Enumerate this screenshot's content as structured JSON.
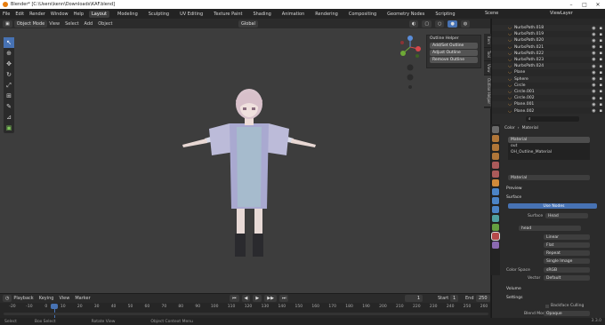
{
  "title_bar": {
    "text": "Blender* [C:\\Users\\kenn\\Downloads\\KAF.blend]"
  },
  "menu": [
    "File",
    "Edit",
    "Render",
    "Window",
    "Help"
  ],
  "workspaces": [
    {
      "label": "Layout",
      "active": true
    },
    {
      "label": "Modeling"
    },
    {
      "label": "Sculpting"
    },
    {
      "label": "UV Editing"
    },
    {
      "label": "Texture Paint"
    },
    {
      "label": "Shading"
    },
    {
      "label": "Animation"
    },
    {
      "label": "Rendering"
    },
    {
      "label": "Compositing"
    },
    {
      "label": "Geometry Nodes"
    },
    {
      "label": "Scripting"
    }
  ],
  "scene": {
    "label": "Scene"
  },
  "view_layer": {
    "label": "ViewLayer"
  },
  "viewport_header": {
    "mode": "Object Mode",
    "menus": [
      "View",
      "Select",
      "Add",
      "Object"
    ],
    "orientation": "Global",
    "options": "Options"
  },
  "outline_helper": {
    "title": "Outline Helper",
    "buttons": [
      "Add/Set Outline",
      "Adjust Outline",
      "Remove Outline"
    ]
  },
  "side_tabs": [
    "Item",
    "Tool",
    "View",
    "Outline Helper"
  ],
  "outliner": {
    "items": [
      "NurbsPath.018",
      "NurbsPath.019",
      "NurbsPath.020",
      "NurbsPath.021",
      "NurbsPath.022",
      "NurbsPath.023",
      "NurbsPath.024",
      "Plane",
      "Sphere",
      "Circle",
      "Circle.001",
      "Circle.002",
      "Plane.001",
      "Plane.002"
    ]
  },
  "properties": {
    "breadcrumb": [
      "Color",
      "Material"
    ],
    "slots": [
      "Material",
      "out",
      "OH_Outline_Material"
    ],
    "material_name": "Material",
    "preview": "Preview",
    "surface_section": "Surface",
    "use_nodes": "Use Nodes",
    "surface_label": "Surface",
    "surface_value": "Head",
    "image": "head",
    "interpolation": "Linear",
    "projection": "Flat",
    "extension": "Repeat",
    "source": "Single Image",
    "color_space_label": "Color Space",
    "color_space": "sRGB",
    "vector_label": "Vector",
    "vector": "Default",
    "volume": "Volume",
    "settings": "Settings",
    "backface": "Backface Culling",
    "blend_mode_label": "Blend Mode",
    "blend_mode": "Opaque"
  },
  "timeline": {
    "menus": [
      "Playback",
      "Keying",
      "View",
      "Marker"
    ],
    "current_frame": "1",
    "start_label": "Start",
    "start": "1",
    "end_label": "End",
    "end": "250",
    "ticks": [
      "-20",
      "-10",
      "0",
      "10",
      "20",
      "30",
      "40",
      "50",
      "60",
      "70",
      "80",
      "90",
      "100",
      "110",
      "120",
      "130",
      "140",
      "150",
      "160",
      "170",
      "180",
      "190",
      "200",
      "210",
      "220",
      "230",
      "240",
      "250",
      "260"
    ]
  },
  "status": {
    "select": "Select",
    "box_select": "Box Select",
    "rotate": "Rotate View",
    "context": "Object Context Menu",
    "version": "3.3.0"
  },
  "colors": {
    "accent": "#4772b3",
    "header": "#2b2b2b",
    "viewport": "#3d3d3d",
    "logo": "#e87d0d"
  }
}
